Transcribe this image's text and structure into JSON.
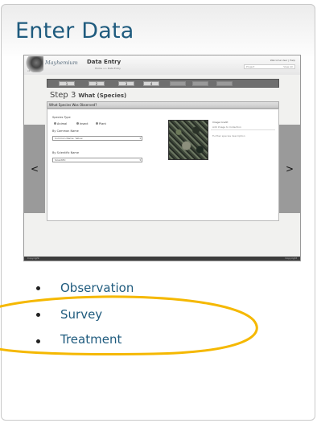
{
  "panel": {
    "title": "Enter Data"
  },
  "screenshot": {
    "logo_text": "Mayhemium",
    "app_title": "Data Entry",
    "breadcrumb": "Home >> Data Entry",
    "version": "v1",
    "user_text": "Welcome User | Help",
    "box_left": "Project",
    "box_right": "View All",
    "step_tabs": [
      "1",
      "2",
      "3",
      "4",
      "5",
      "6",
      "7"
    ],
    "step_heading": "Step 3",
    "step_subheading": "What (Species)",
    "question": "What Species Was Observed?",
    "species_type_label": "Species Type",
    "species_types": [
      "Animal",
      "Insect",
      "Plant"
    ],
    "common_name_label": "By Common Name",
    "common_name_value": "Common Name: Yellow",
    "scientific_name_label": "By Scientific Name",
    "scientific_name_value": "Scientific",
    "image_credit": "Image Credit",
    "image_link": "Add Image to Collection",
    "image_desc": "Further species description",
    "prev_arrow": "<",
    "next_arrow": ">",
    "footer_left": "Copyright",
    "footer_right": "Copyright"
  },
  "list": {
    "items": [
      "Observation",
      "Survey",
      "Treatment"
    ]
  },
  "colors": {
    "title": "#1f5b7e",
    "highlight": "#f5b800"
  }
}
